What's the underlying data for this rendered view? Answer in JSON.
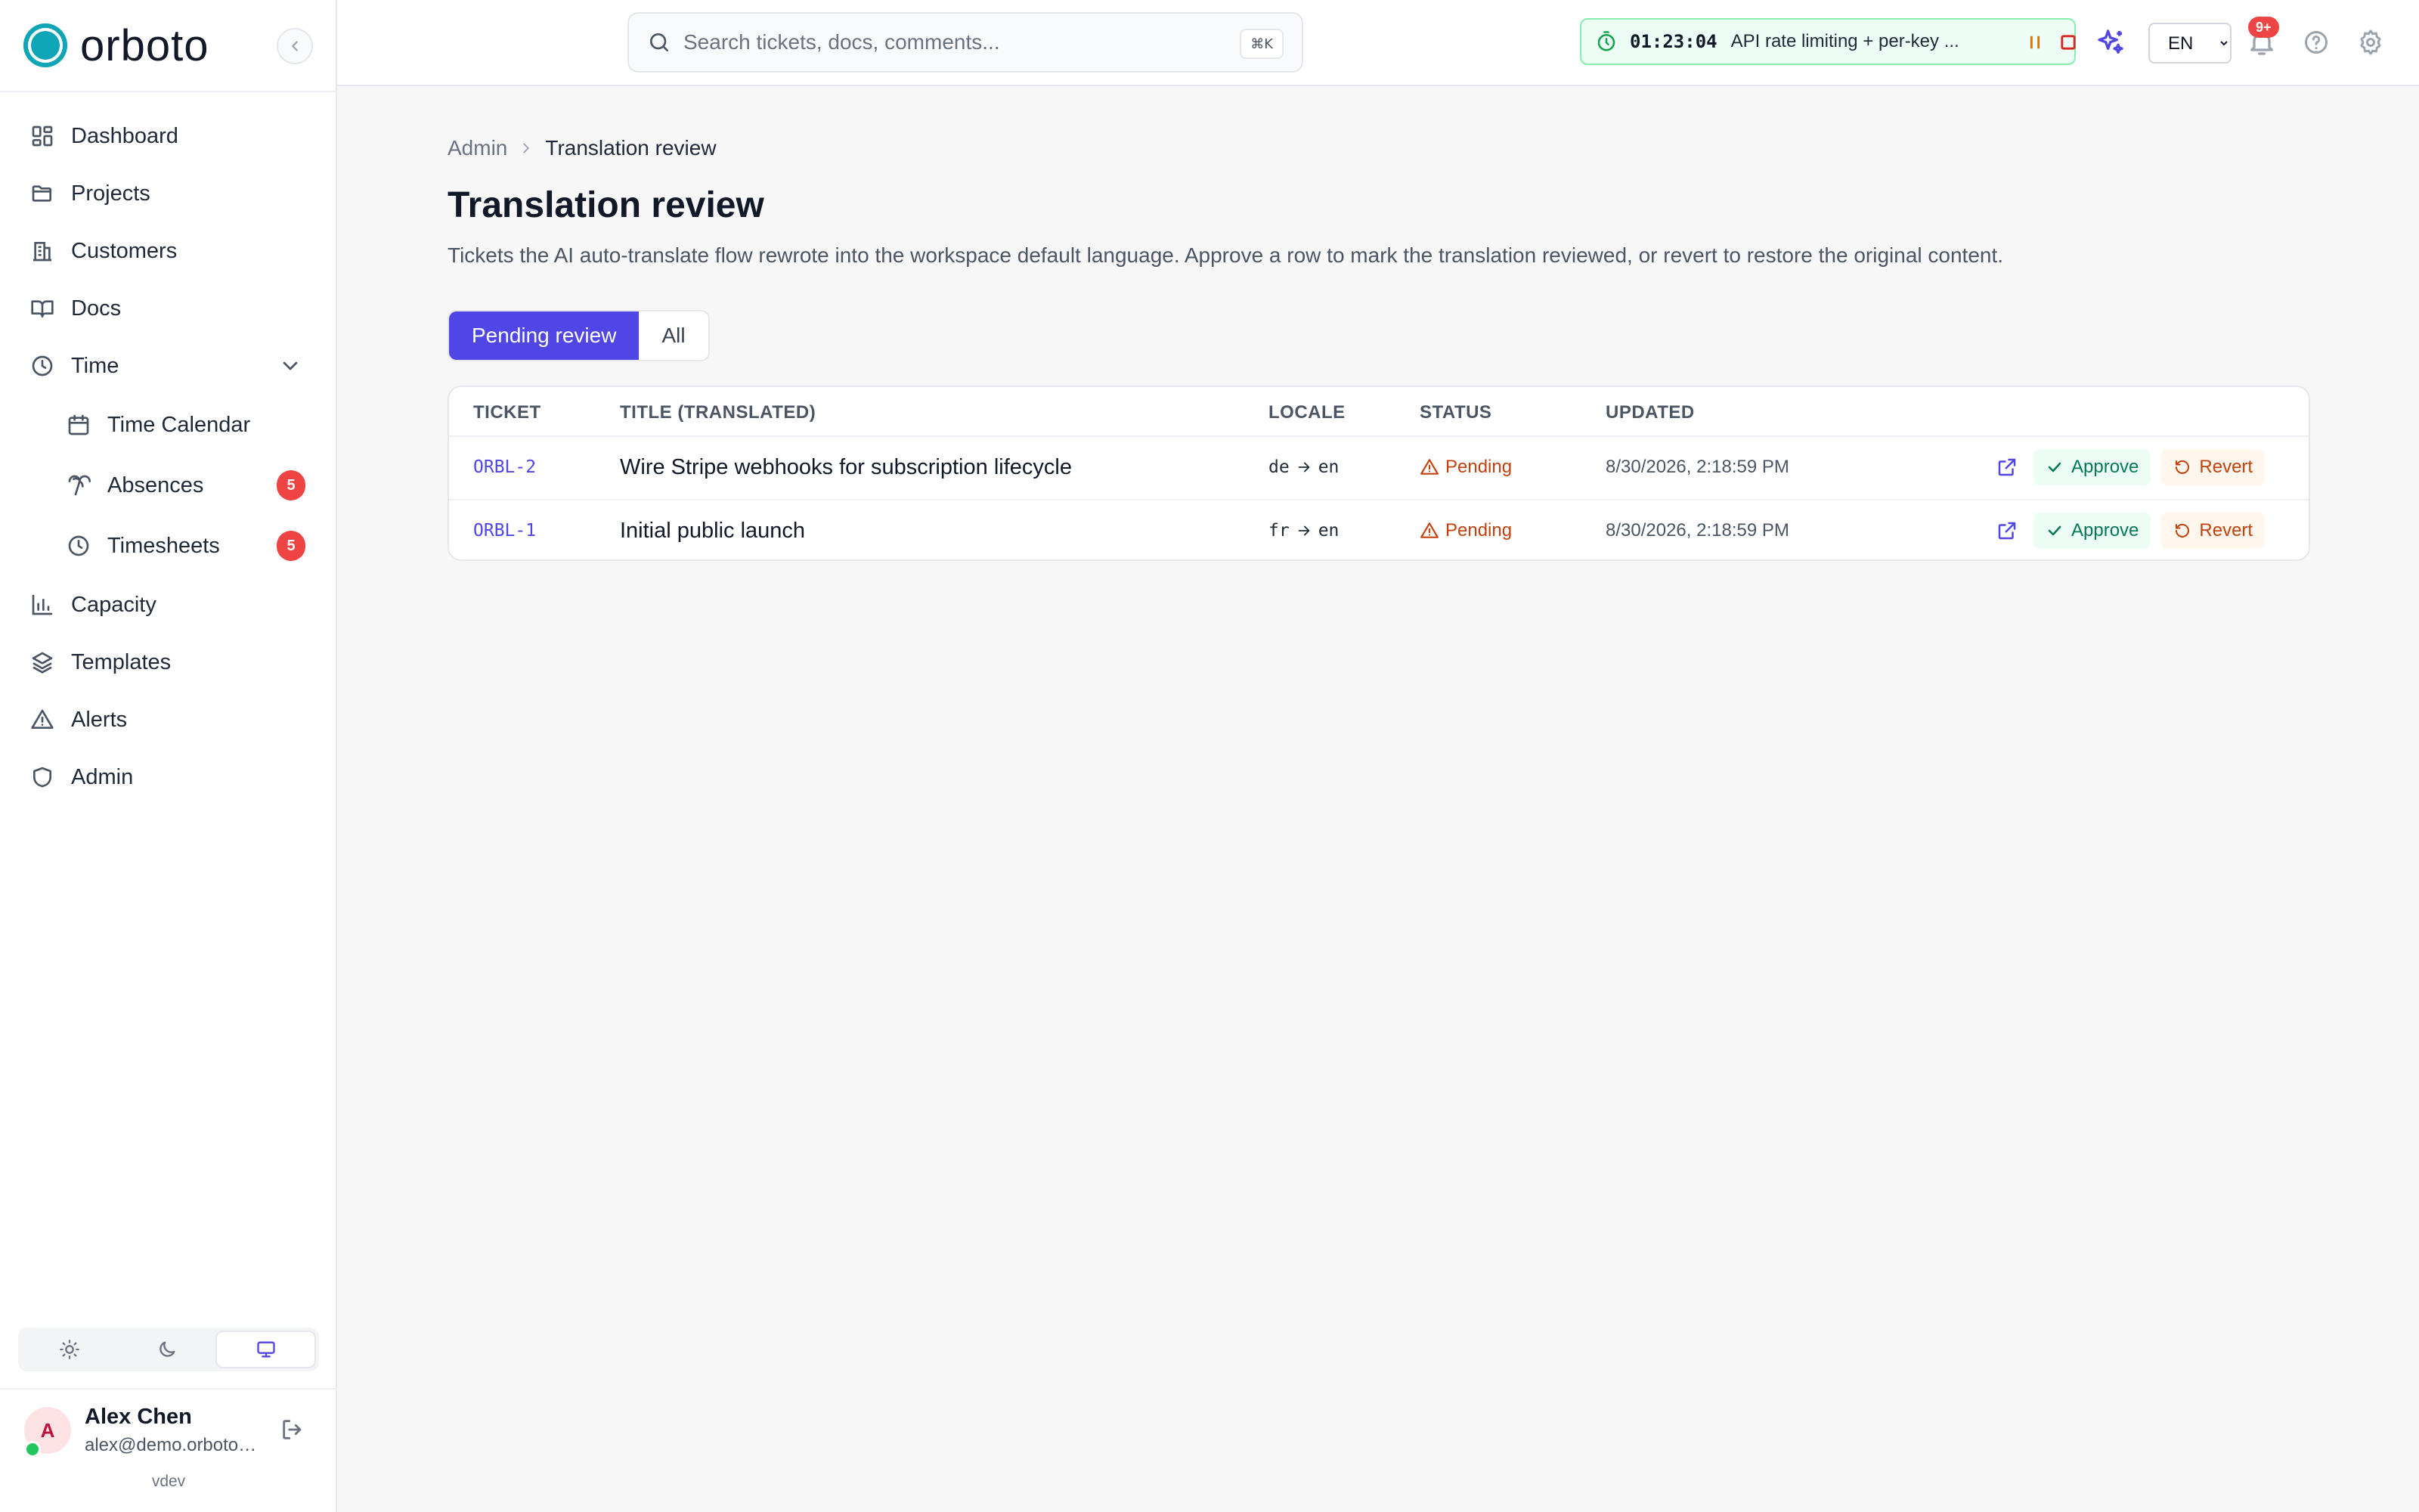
{
  "brand": {
    "name": "orboto",
    "accent": "#0ea5b7"
  },
  "sidebar": {
    "items": [
      {
        "label": "Dashboard",
        "icon": "dashboard-icon"
      },
      {
        "label": "Projects",
        "icon": "folder-icon"
      },
      {
        "label": "Customers",
        "icon": "building-icon"
      },
      {
        "label": "Docs",
        "icon": "book-icon"
      },
      {
        "label": "Time",
        "icon": "clock-icon",
        "expanded": true
      },
      {
        "label": "Time Calendar",
        "icon": "calendar-icon"
      },
      {
        "label": "Absences",
        "icon": "palm-tree-icon",
        "badge": "5"
      },
      {
        "label": "Timesheets",
        "icon": "clock-icon",
        "badge": "5"
      },
      {
        "label": "Capacity",
        "icon": "bar-chart-icon"
      },
      {
        "label": "Templates",
        "icon": "layers-icon"
      },
      {
        "label": "Alerts",
        "icon": "alert-triangle-icon"
      },
      {
        "label": "Admin",
        "icon": "shield-icon"
      }
    ]
  },
  "theme": {
    "options": [
      "light",
      "dark",
      "system"
    ],
    "selected": "system"
  },
  "user": {
    "initial": "A",
    "name": "Alex Chen",
    "email": "alex@demo.orboto.app",
    "status": "online"
  },
  "version": "vdev",
  "topbar": {
    "search_placeholder": "Search tickets, docs, comments...",
    "shortcut": "⌘K",
    "timer": {
      "elapsed": "01:23:04",
      "task": "API rate limiting + per-key ..."
    },
    "language": "EN",
    "notifications_badge": "9+"
  },
  "breadcrumb": {
    "parent": "Admin",
    "current": "Translation review"
  },
  "page": {
    "title": "Translation review",
    "description": "Tickets the AI auto-translate flow rewrote into the workspace default language. Approve a row to mark the translation reviewed, or revert to restore the original content."
  },
  "tabs": [
    {
      "label": "Pending review",
      "active": true
    },
    {
      "label": "All",
      "active": false
    }
  ],
  "table": {
    "columns": [
      "TICKET",
      "TITLE (TRANSLATED)",
      "LOCALE",
      "STATUS",
      "UPDATED"
    ],
    "rows": [
      {
        "ticket": "ORBL-2",
        "title": "Wire Stripe webhooks for subscription lifecycle",
        "locale_from": "de",
        "locale_to": "en",
        "status": "Pending",
        "updated": "8/30/2026, 2:18:59 PM"
      },
      {
        "ticket": "ORBL-1",
        "title": "Initial public launch",
        "locale_from": "fr",
        "locale_to": "en",
        "status": "Pending",
        "updated": "8/30/2026, 2:18:59 PM"
      }
    ],
    "approve_label": "Approve",
    "revert_label": "Revert"
  }
}
